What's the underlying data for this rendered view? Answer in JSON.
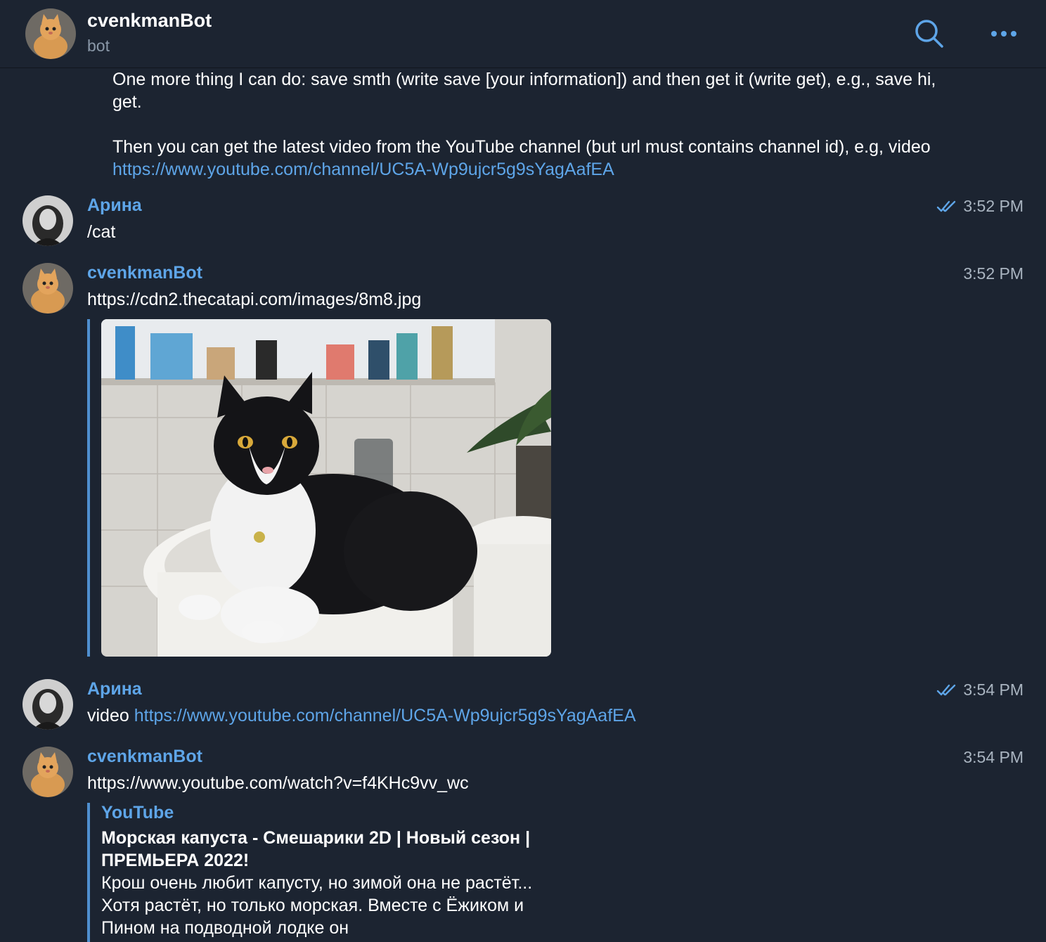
{
  "header": {
    "title": "cvenkmanBot",
    "subtitle": "bot"
  },
  "intro": {
    "line1": "One more thing I can do: save smth (write save [your information]) and then get it (write get), e.g., save hi, get.",
    "line2_prefix": "Then you can get the latest video from the YouTube channel (but url must contains channel id), e.g, video ",
    "line2_link": "https://www.youtube.com/channel/UC5A-Wp9ujcr5g9sYagAafEA"
  },
  "messages": [
    {
      "sender": "Арина",
      "time": "3:52 PM",
      "read": true,
      "text": "/cat"
    },
    {
      "sender": "cvenkmanBot",
      "time": "3:52 PM",
      "link": "https://cdn2.thecatapi.com/images/8m8.jpg"
    },
    {
      "sender": "Арина",
      "time": "3:54 PM",
      "read": true,
      "text_prefix": "video ",
      "link": "https://www.youtube.com/channel/UC5A-Wp9ujcr5g9sYagAafEA"
    },
    {
      "sender": "cvenkmanBot",
      "time": "3:54 PM",
      "link": "https://www.youtube.com/watch?v=f4KHc9vv_wc",
      "preview": {
        "site": "YouTube",
        "title": "Морская капуста - Смешарики 2D | Новый сезон | ПРЕМЬЕРА 2022!",
        "description": "Крош очень любит капусту, но зимой она не растёт... Хотя растёт, но только морская. Вместе с Ёжиком и Пином на подводной лодке он"
      }
    }
  ],
  "icons": {
    "search": "search-icon",
    "more": "more-icon",
    "read": "double-check-icon"
  },
  "colors": {
    "background": "#1c2431",
    "accent": "#5ea5e8",
    "text": "#ffffff",
    "muted": "#a9b4c0"
  }
}
